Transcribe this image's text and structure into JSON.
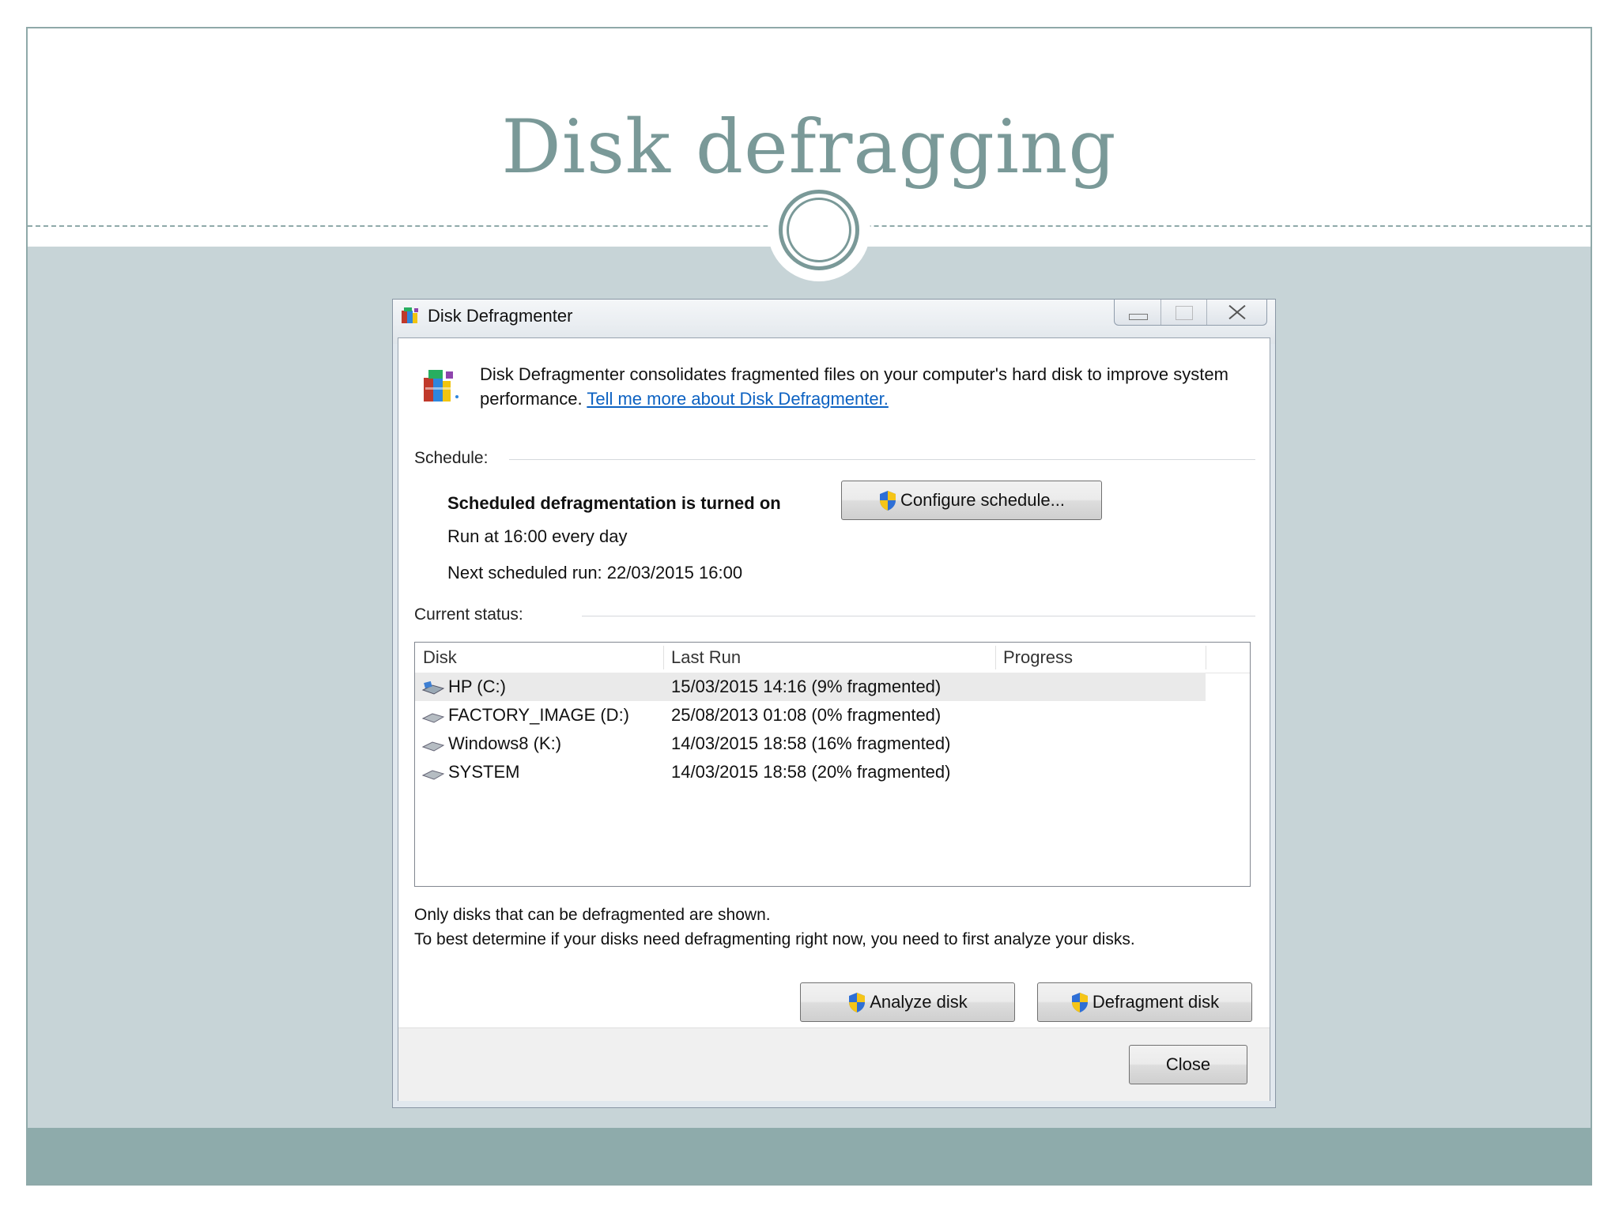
{
  "slide": {
    "title": "Disk defragging"
  },
  "window": {
    "title": "Disk Defragmenter",
    "intro_text": "Disk Defragmenter consolidates fragmented files on your computer's hard disk to improve system performance.",
    "intro_link": "Tell me more about Disk Defragmenter.",
    "schedule": {
      "label": "Schedule:",
      "status": "Scheduled defragmentation is turned on",
      "run_at": "Run at 16:00 every day",
      "next_run": "Next scheduled run: 22/03/2015 16:00",
      "configure_button": "Configure schedule..."
    },
    "current_status": {
      "label": "Current status:",
      "columns": [
        "Disk",
        "Last Run",
        "Progress"
      ],
      "disks": [
        {
          "name": "HP (C:)",
          "last_run": "15/03/2015 14:16 (9% fragmented)",
          "progress": "",
          "selected": true,
          "icon": "system-drive-icon"
        },
        {
          "name": "FACTORY_IMAGE (D:)",
          "last_run": "25/08/2013 01:08 (0% fragmented)",
          "progress": "",
          "selected": false,
          "icon": "drive-icon"
        },
        {
          "name": "Windows8 (K:)",
          "last_run": "14/03/2015 18:58 (16% fragmented)",
          "progress": "",
          "selected": false,
          "icon": "drive-icon"
        },
        {
          "name": "SYSTEM",
          "last_run": "14/03/2015 18:58 (20% fragmented)",
          "progress": "",
          "selected": false,
          "icon": "drive-icon"
        }
      ]
    },
    "notes": {
      "line1": "Only disks that can be defragmented are shown.",
      "line2": "To best determine if your disks need defragmenting right now, you need to first analyze your disks."
    },
    "buttons": {
      "analyze": "Analyze disk",
      "defragment": "Defragment disk",
      "close": "Close"
    }
  },
  "colors": {
    "slide_accent": "#7a9998",
    "slide_body_bg": "#c7d4d7",
    "slide_footer_bg": "#8eabab",
    "link": "#0d62c2"
  }
}
